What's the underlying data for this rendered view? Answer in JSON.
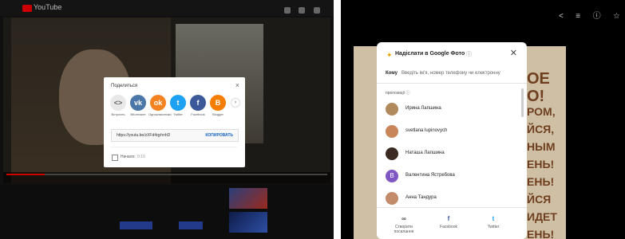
{
  "youtube": {
    "logo_text": "YouTube",
    "share_dialog": {
      "title": "Поделиться",
      "close_glyph": "×",
      "services": [
        {
          "label": "Встроить",
          "glyph": "<>",
          "color": "#e8e8e8",
          "fg": "#666",
          "icon": "embed-icon"
        },
        {
          "label": "ВКонтакте",
          "glyph": "vk",
          "color": "#4a76a8",
          "fg": "#fff",
          "icon": "vk-icon"
        },
        {
          "label": "Одноклассники",
          "glyph": "ok",
          "color": "#f58220",
          "fg": "#fff",
          "icon": "odnoklassniki-icon"
        },
        {
          "label": "Twitter",
          "glyph": "t",
          "color": "#1da1f2",
          "fg": "#fff",
          "icon": "twitter-icon"
        },
        {
          "label": "Facebook",
          "glyph": "f",
          "color": "#3b5998",
          "fg": "#fff",
          "icon": "facebook-icon"
        },
        {
          "label": "Blogger",
          "glyph": "B",
          "color": "#f57d00",
          "fg": "#fff",
          "icon": "blogger-icon"
        }
      ],
      "next_glyph": "›",
      "link": "https://youtu.be/zXFd4qyhnhD",
      "copy_label": "КОПИРОВАТЬ",
      "start_label": "Начало:",
      "start_time": "0:19"
    }
  },
  "photos_dialog": {
    "title": "Надіслати в Google Фото",
    "help_glyph": "?",
    "close_glyph": "✕",
    "to_label": "Кому",
    "to_placeholder": "Введіть ім'я, номер телефону чи електронну",
    "suggestions_label": "пропозиції ⓘ",
    "contacts": [
      {
        "name": "Ирина Лапшина",
        "avatar_color": "#b08a5c",
        "initial": ""
      },
      {
        "name": "svetlana lupinovych",
        "avatar_color": "#c9855a",
        "initial": ""
      },
      {
        "name": "Наташа Лапшина",
        "avatar_color": "#3a2a22",
        "initial": ""
      },
      {
        "name": "Валентина Ястребова",
        "avatar_color": "#7e57c2",
        "initial": "В"
      },
      {
        "name": "Анна Тандура",
        "avatar_color": "#c48b6a",
        "initial": ""
      }
    ],
    "actions": [
      {
        "label": "Створити посилання",
        "glyph": "∞",
        "color": "#444",
        "icon": "link-icon"
      },
      {
        "label": "Facebook",
        "glyph": "f",
        "color": "#3b5998",
        "icon": "facebook-icon"
      },
      {
        "label": "Twitter",
        "glyph": "t",
        "color": "#1da1f2",
        "icon": "twitter-icon"
      }
    ]
  },
  "poster_text": [
    "ОЕ",
    "О!",
    "РОМ,",
    "ЙСЯ,",
    "НЫМ",
    "ЕНЬ!",
    "ЕНЬ!",
    "ЙСЯ",
    "ИДЕТ",
    "ЕНЬ!"
  ]
}
